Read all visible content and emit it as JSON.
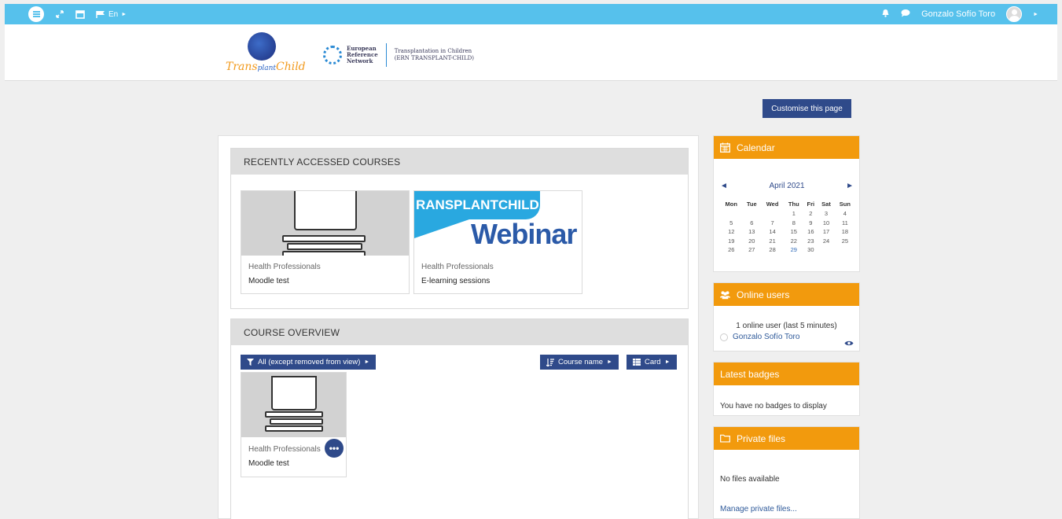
{
  "topbar": {
    "lang": "En",
    "user_name": "Gonzalo Sofío Toro"
  },
  "header": {
    "logo_tc_prefix": "Trans",
    "logo_tc_mid": "plant",
    "logo_tc_suffix": "Child",
    "ern_line1": "European",
    "ern_line2": "Reference",
    "ern_line3": "Network",
    "ern_sub1": "Transplantation in Children",
    "ern_sub2": "(ERN TRANSPLANT-CHILD)"
  },
  "customise_label": "Customise this page",
  "recent": {
    "title": "RECENTLY ACCESSED COURSES",
    "courses": [
      {
        "category": "Health Professionals",
        "name": "Moodle test"
      },
      {
        "category": "Health Professionals",
        "name": "E-learning sessions",
        "banner_top": "RANSPLANTCHILD",
        "banner_word": "Webinar"
      }
    ]
  },
  "overview": {
    "title": "COURSE OVERVIEW",
    "filter_label": "All (except removed from view)",
    "sort_label": "Course name",
    "view_label": "Card",
    "course": {
      "category": "Health Professionals",
      "name": "Moodle test"
    }
  },
  "calendar": {
    "title": "Calendar",
    "month": "April 2021",
    "prev": "◄",
    "next": "►",
    "days": [
      "Mon",
      "Tue",
      "Wed",
      "Thu",
      "Fri",
      "Sat",
      "Sun"
    ],
    "weeks": [
      [
        "",
        "",
        "",
        "1",
        "2",
        "3",
        "4"
      ],
      [
        "5",
        "6",
        "7",
        "8",
        "9",
        "10",
        "11"
      ],
      [
        "12",
        "13",
        "14",
        "15",
        "16",
        "17",
        "18"
      ],
      [
        "19",
        "20",
        "21",
        "22",
        "23",
        "24",
        "25"
      ],
      [
        "26",
        "27",
        "28",
        "29",
        "30",
        "",
        ""
      ]
    ],
    "today": "29"
  },
  "online": {
    "title": "Online users",
    "summary": "1 online user (last 5 minutes)",
    "user": "Gonzalo Sofío Toro"
  },
  "badges": {
    "title": "Latest badges",
    "message": "You have no badges to display"
  },
  "files": {
    "title": "Private files",
    "message": "No files available",
    "manage_link": "Manage private files..."
  },
  "colors": {
    "topbar": "#56c1ec",
    "primary": "#2f4a8a",
    "block_header": "#f29a0d"
  }
}
